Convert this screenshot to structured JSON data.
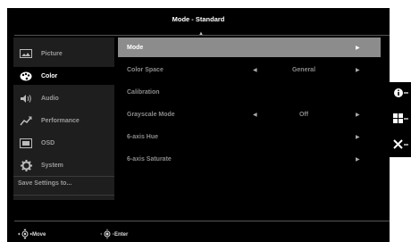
{
  "osd": {
    "title": "Mode - Standard",
    "sidebar": [
      {
        "label": "Picture",
        "icon": "picture-icon",
        "active": false
      },
      {
        "label": "Color",
        "icon": "color-palette-icon",
        "active": true
      },
      {
        "label": "Audio",
        "icon": "speaker-icon",
        "active": false
      },
      {
        "label": "Performance",
        "icon": "performance-graph-icon",
        "active": false
      },
      {
        "label": "OSD",
        "icon": "osd-screen-icon",
        "active": false
      },
      {
        "label": "System",
        "icon": "gear-icon",
        "active": false
      }
    ],
    "save_label": "Save Settings to...",
    "menu": [
      {
        "label": "Mode",
        "value": "",
        "left_arrow": false,
        "right_arrow": true,
        "selected": true
      },
      {
        "label": "Color Space",
        "value": "General",
        "left_arrow": true,
        "right_arrow": true,
        "selected": false
      },
      {
        "label": "Calibration",
        "value": "",
        "left_arrow": false,
        "right_arrow": false,
        "selected": false
      },
      {
        "label": "Grayscale Mode",
        "value": "Off",
        "left_arrow": true,
        "right_arrow": true,
        "selected": false
      },
      {
        "label": "6-axis Hue",
        "value": "",
        "left_arrow": false,
        "right_arrow": true,
        "selected": false
      },
      {
        "label": "6-axis Saturate",
        "value": "",
        "left_arrow": false,
        "right_arrow": true,
        "selected": false
      }
    ],
    "footer": {
      "move_label": "Move",
      "enter_label": "Enter"
    },
    "hotkeys": [
      "info-icon",
      "grid-icon",
      "close-icon"
    ]
  }
}
